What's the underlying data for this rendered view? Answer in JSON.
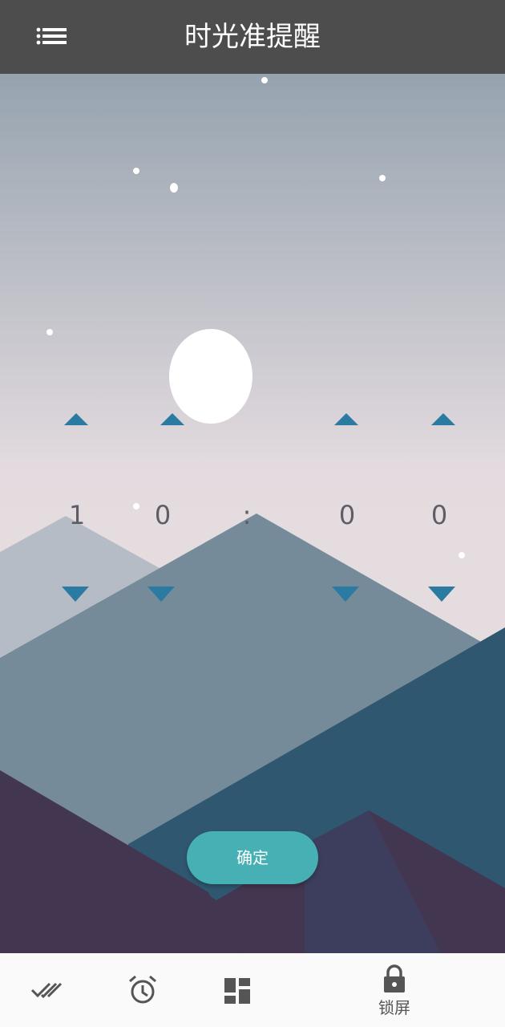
{
  "header": {
    "title": "时光准提醒",
    "menu_icon": "list-menu-icon"
  },
  "time_picker": {
    "digits": [
      "1",
      "0",
      ":",
      "0",
      "0"
    ],
    "arrow_color": "#2b7aa1"
  },
  "confirm_button": {
    "label": "确定",
    "color": "#47b0b4"
  },
  "bottom_nav": {
    "tabs": [
      {
        "icon": "done-all-icon",
        "label": ""
      },
      {
        "icon": "alarm-clock-icon",
        "label": ""
      },
      {
        "icon": "dashboard-icon",
        "label": ""
      },
      {
        "icon": "lock-icon",
        "label": "锁屏"
      }
    ]
  },
  "colors": {
    "header_bg": "#4d4d4d",
    "sky_top": "#96a3af",
    "sky_bottom": "#e9dfe0",
    "mountain_light": "#b6bcc5",
    "mountain_mid": "#758b9a",
    "mountain_dark": "#2f5870",
    "ground_purple": "#433650"
  }
}
